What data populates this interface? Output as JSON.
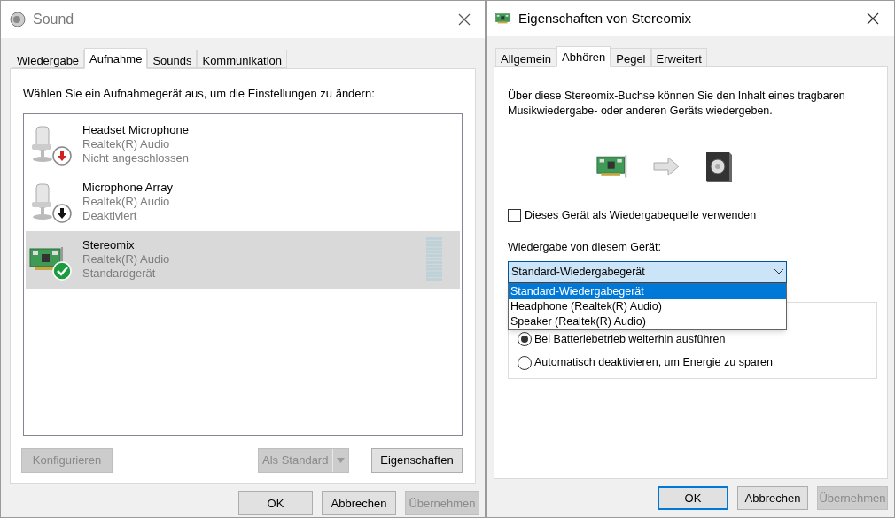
{
  "sound_window": {
    "title": "Sound",
    "tabs": [
      {
        "label": "Wiedergabe",
        "selected": false
      },
      {
        "label": "Aufnahme",
        "selected": true
      },
      {
        "label": "Sounds",
        "selected": false
      },
      {
        "label": "Kommunikation",
        "selected": false
      }
    ],
    "instruction": "Wählen Sie ein Aufnahmegerät aus, um die Einstellungen zu ändern:",
    "devices": [
      {
        "name": "Headset Microphone",
        "driver": "Realtek(R) Audio",
        "status": "Nicht angeschlossen",
        "icon": {
          "kind": "microphone"
        },
        "badge": {
          "kind": "unplugged"
        },
        "selected": false,
        "meter": false
      },
      {
        "name": "Microphone Array",
        "driver": "Realtek(R) Audio",
        "status": "Deaktiviert",
        "icon": {
          "kind": "microphone"
        },
        "badge": {
          "kind": "disabled"
        },
        "selected": false,
        "meter": false
      },
      {
        "name": "Stereomix",
        "driver": "Realtek(R) Audio",
        "status": "Standardgerät",
        "icon": {
          "kind": "card"
        },
        "badge": {
          "kind": "default"
        },
        "selected": true,
        "meter": true
      }
    ],
    "device_buttons": [
      {
        "label": "Konfigurieren",
        "disabled": true,
        "kind": "plain"
      },
      {
        "label": "Als Standard",
        "disabled": true,
        "kind": "split"
      },
      {
        "label": "Eigenschaften",
        "disabled": false,
        "kind": "plain"
      }
    ],
    "buttons": [
      {
        "label": "OK",
        "disabled": false,
        "default": false
      },
      {
        "label": "Abbrechen",
        "disabled": false,
        "default": false
      },
      {
        "label": "Übernehmen",
        "disabled": true,
        "default": false
      }
    ]
  },
  "properties_window": {
    "title": "Eigenschaften von Stereomix",
    "tabs": [
      {
        "label": "Allgemein",
        "selected": false
      },
      {
        "label": "Abhören",
        "selected": true
      },
      {
        "label": "Pegel",
        "selected": false
      },
      {
        "label": "Erweitert",
        "selected": false
      }
    ],
    "description": "Über diese Stereomix-Buchse können Sie den Inhalt eines tragbaren Musikwiedergabe- oder anderen Geräts wiedergeben.",
    "listen_checkbox": {
      "label": "Dieses Gerät als Wiedergabequelle verwenden",
      "checked": false
    },
    "playback_label": "Wiedergabe von diesem Gerät:",
    "playback_dropdown": {
      "value": "Standard-Wiedergabegerät",
      "expanded": true,
      "options": [
        {
          "label": "Standard-Wiedergabegerät",
          "selected": true
        },
        {
          "label": "Headphone (Realtek(R) Audio)",
          "selected": false
        },
        {
          "label": "Speaker (Realtek(R) Audio)",
          "selected": false
        }
      ]
    },
    "power_options": [
      {
        "label": "Bei Batteriebetrieb weiterhin ausführen",
        "selected": true
      },
      {
        "label": "Automatisch deaktivieren, um Energie zu sparen",
        "selected": false
      }
    ],
    "buttons": [
      {
        "label": "OK",
        "disabled": false,
        "default": true
      },
      {
        "label": "Abbrechen",
        "disabled": false,
        "default": false
      },
      {
        "label": "Übernehmen",
        "disabled": true,
        "default": false
      }
    ]
  }
}
